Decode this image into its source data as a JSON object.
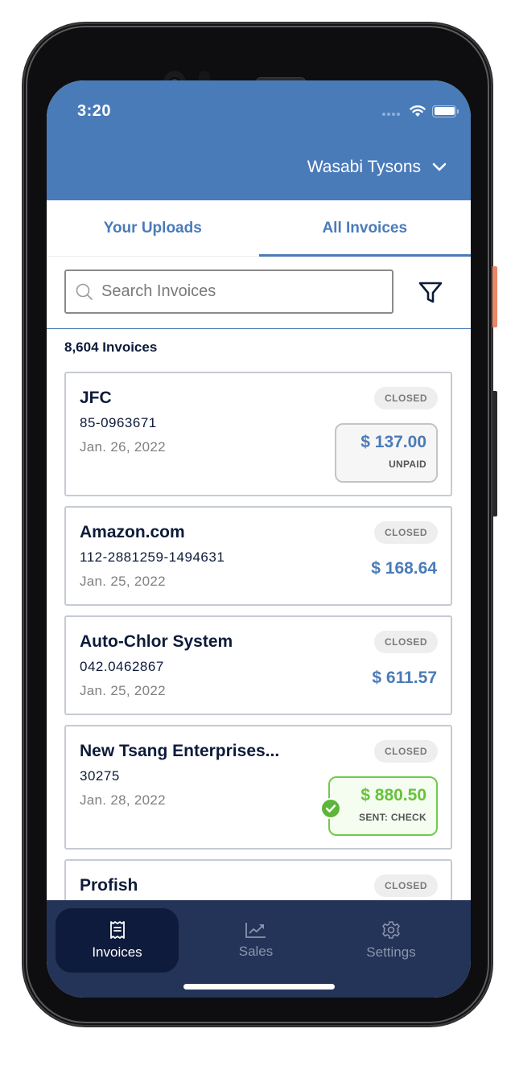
{
  "status_bar": {
    "time": "3:20",
    "icons": [
      "signal-dots-icon",
      "wifi-icon",
      "battery-icon"
    ]
  },
  "header": {
    "location": "Wasabi Tysons",
    "location_icon": "chevron-down-icon",
    "brand_color": "#4a7bb9"
  },
  "tabs": [
    {
      "label": "Your Uploads",
      "active": false
    },
    {
      "label": "All Invoices",
      "active": true
    }
  ],
  "search": {
    "placeholder": "Search Invoices",
    "value": "",
    "icon": "search-icon",
    "filter_icon": "filter-icon"
  },
  "invoice_count": "8,604 Invoices",
  "invoices": [
    {
      "vendor": "JFC",
      "number": "85-0963671",
      "date": "Jan. 26, 2022",
      "status": "CLOSED",
      "amount": "$ 137.00",
      "payment_status": "UNPAID"
    },
    {
      "vendor": "Amazon.com",
      "number": "112-2881259-1494631",
      "date": "Jan. 25, 2022",
      "status": "CLOSED",
      "amount": "$ 168.64"
    },
    {
      "vendor": "Auto-Chlor System",
      "number": "042.0462867",
      "date": "Jan. 25, 2022",
      "status": "CLOSED",
      "amount": "$ 611.57"
    },
    {
      "vendor": "New Tsang Enterprises...",
      "number": "30275",
      "date": "Jan. 28, 2022",
      "status": "CLOSED",
      "amount": "$ 880.50",
      "payment_status": "SENT: CHECK"
    },
    {
      "vendor": "Profish",
      "status": "CLOSED"
    }
  ],
  "bottom_nav": [
    {
      "label": "Invoices",
      "icon": "receipt-icon",
      "active": true
    },
    {
      "label": "Sales",
      "icon": "chart-icon",
      "active": false
    },
    {
      "label": "Settings",
      "icon": "gear-icon",
      "active": false
    }
  ],
  "colors": {
    "accent": "#4a7bb9",
    "nav_bg": "#243358",
    "nav_active": "#0f1b3c",
    "paid_green": "#68c23c",
    "text_dark": "#0d1b3a"
  }
}
